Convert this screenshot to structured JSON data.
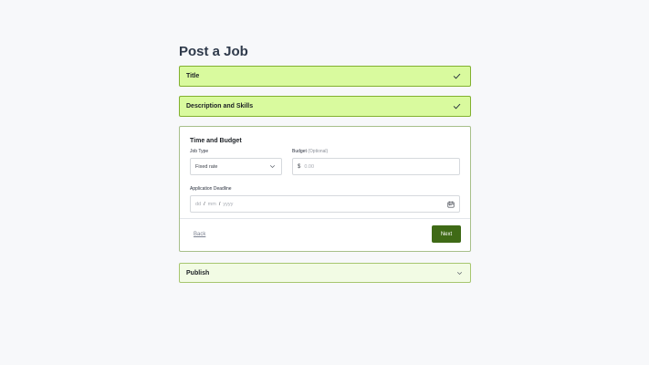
{
  "page": {
    "title": "Post a Job"
  },
  "steps": {
    "title": {
      "label": "Title",
      "icon": "check-icon"
    },
    "description": {
      "label": "Description and Skills",
      "icon": "check-icon"
    },
    "publish": {
      "label": "Publish",
      "icon": "chevron-down-icon"
    }
  },
  "time_budget": {
    "heading": "Time and Budget",
    "job_type": {
      "label": "Job Type",
      "value": "Fixed rate"
    },
    "budget": {
      "label": "Budget",
      "optional": "(Optional)",
      "currency": "$",
      "placeholder": "0.00"
    },
    "deadline": {
      "label": "Application Deadline",
      "dd": "dd",
      "mm": "mm",
      "yyyy": "yyyy",
      "sep": "/"
    },
    "back_label": "Back",
    "next_label": "Next"
  },
  "colors": {
    "completed_bg": "#d9fa9e",
    "pending_bg": "#f2fbe4",
    "primary_button": "#3f6a16"
  }
}
